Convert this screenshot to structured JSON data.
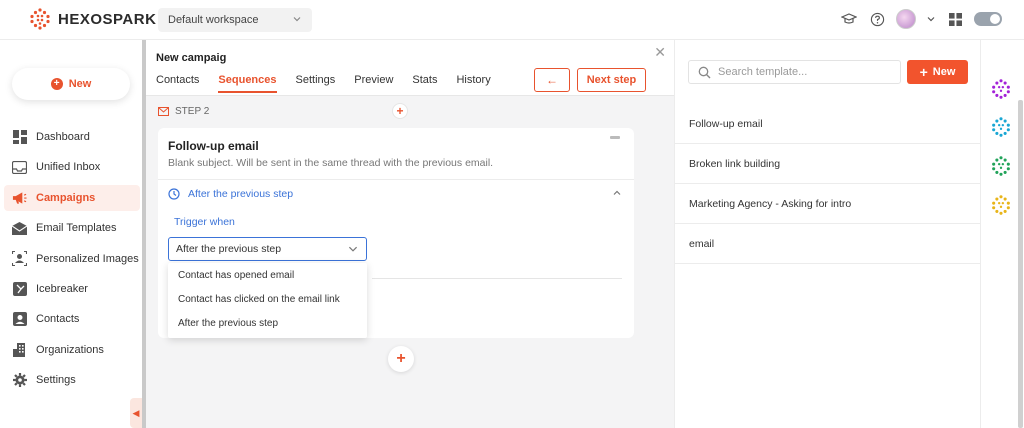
{
  "app": {
    "name": "HEXOSPARK"
  },
  "workspace": {
    "label": "Default workspace"
  },
  "colors": {
    "accent": "#e8532e",
    "link": "#3b73d8"
  },
  "sidebar": {
    "new_label": "New",
    "items": [
      {
        "label": "Dashboard",
        "icon": "dashboard-icon",
        "active": false
      },
      {
        "label": "Unified Inbox",
        "icon": "inbox-icon",
        "active": false
      },
      {
        "label": "Campaigns",
        "icon": "megaphone-icon",
        "active": true
      },
      {
        "label": "Email Templates",
        "icon": "envelope-icon",
        "active": false
      },
      {
        "label": "Personalized Images",
        "icon": "user-image-icon",
        "active": false
      },
      {
        "label": "Icebreaker",
        "icon": "icebreaker-icon",
        "active": false
      },
      {
        "label": "Contacts",
        "icon": "contact-icon",
        "active": false
      },
      {
        "label": "Organizations",
        "icon": "building-icon",
        "active": false
      },
      {
        "label": "Settings",
        "icon": "gear-icon",
        "active": false
      }
    ]
  },
  "campaign": {
    "title": "New campaig",
    "tabs": [
      "Contacts",
      "Sequences",
      "Settings",
      "Preview",
      "Stats",
      "History"
    ],
    "active_tab": "Sequences",
    "back_label": "←",
    "next_label": "Next step"
  },
  "step": {
    "label": "STEP 2",
    "card_title": "Follow-up email",
    "card_subtitle": "Blank subject. Will be sent in the same thread with the previous email.",
    "after_label": "After the previous step",
    "trigger_label": "Trigger when",
    "select_value": "After the previous step",
    "options": [
      "Contact has opened email",
      "Contact has clicked on the email link",
      "After the previous step"
    ]
  },
  "templates": {
    "search_placeholder": "Search template...",
    "new_label": "New",
    "items": [
      "Follow-up email",
      "Broken link building",
      "Marketing Agency - Asking for intro",
      "email"
    ]
  }
}
